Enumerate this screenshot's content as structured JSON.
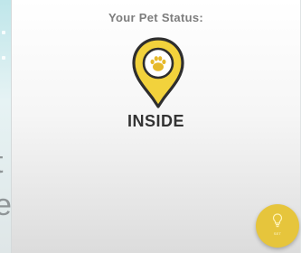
{
  "header": {
    "title": "Your Pet Status:"
  },
  "status": {
    "label": "INSIDE",
    "icon": "paw-location-pin-icon"
  },
  "fab": {
    "label": "SET",
    "icon": "lightbulb-icon"
  },
  "background_fragments": [
    "t",
    "e"
  ],
  "colors": {
    "accent": "#e6c53c",
    "pin_yellow": "#f2d23c",
    "title_gray": "#7d7d7d",
    "status_dark": "#333333"
  }
}
